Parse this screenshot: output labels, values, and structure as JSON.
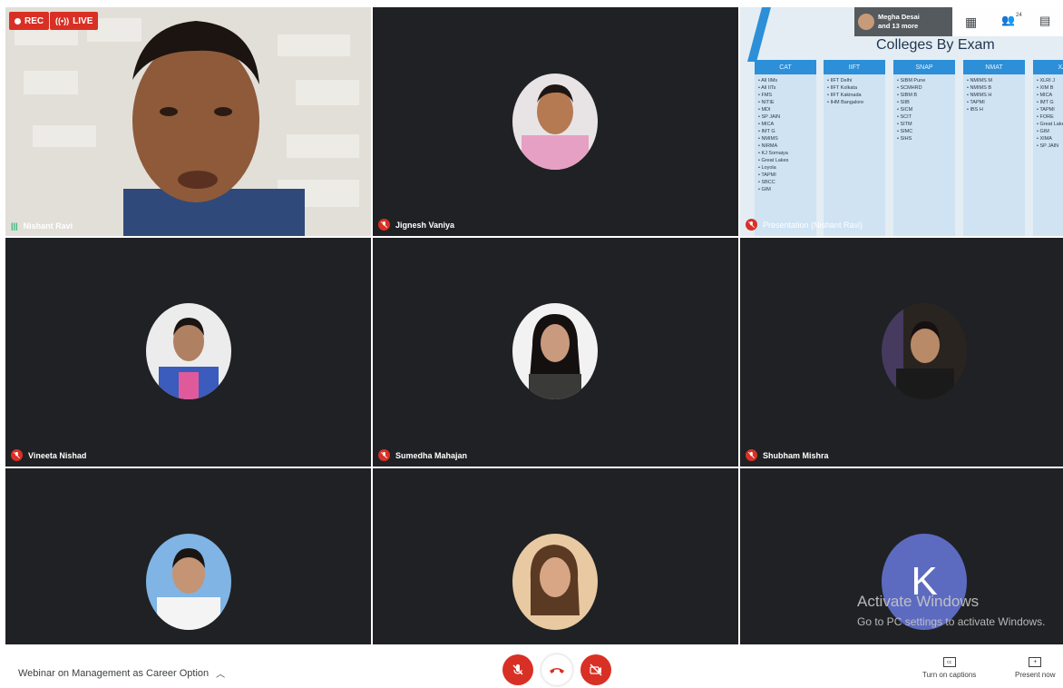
{
  "recording": {
    "rec_label": "REC",
    "live_label": "LIVE"
  },
  "tiles": {
    "nishant": {
      "name": "Nishant Ravi"
    },
    "jignesh": {
      "name": "Jignesh Vaniya"
    },
    "presentation": {
      "name": "Presentation (Nishant Ravi)",
      "slide_title": "Colleges By Exam",
      "columns": [
        {
          "head": "CAT",
          "items": [
            "All IIMs",
            "All IITs",
            "FMS",
            "NITIE",
            "MDI",
            "SP JAIN",
            "MICA",
            "IMT G",
            "NMIMS",
            "NIRMA",
            "KJ Somaiya",
            "Great Lakes",
            "Loyola",
            "TAPMI",
            "SBCC",
            "GIM"
          ]
        },
        {
          "head": "IIFT",
          "items": [
            "IIFT Delhi",
            "IIFT Kolkata",
            "IIFT Kakinada",
            "IHM Bangalore"
          ]
        },
        {
          "head": "SNAP",
          "items": [
            "SIBM Pune",
            "SCMHRD",
            "SIBM B",
            "SIIB",
            "SICM",
            "SCIT",
            "SITM",
            "SIMC",
            "SIHS"
          ]
        },
        {
          "head": "NMAT",
          "items": [
            "NMIMS M",
            "NMIMS B",
            "NMIMS H",
            "TAPMI",
            "IBS H"
          ]
        },
        {
          "head": "XAT",
          "items": [
            "XLRI J",
            "XIM B",
            "MICA",
            "IMT G",
            "TAPMI",
            "FORE",
            "Great Lakes",
            "GIM",
            "XIMA",
            "SP JAIN"
          ]
        }
      ]
    },
    "vineeta": {
      "name": "Vineeta Nishad"
    },
    "sumedha": {
      "name": "Sumedha Mahajan"
    },
    "shubham": {
      "name": "Shubham Mishra"
    },
    "k_user": {
      "initial": "K"
    }
  },
  "people": {
    "line1": "Megha Desai",
    "line2": "and 13 more",
    "count": "24"
  },
  "watermark": {
    "line1": "Activate Windows",
    "line2": "Go to PC settings to activate Windows."
  },
  "toolbar": {
    "meeting_title": "Webinar on Management as Career Option",
    "captions_label": "Turn on captions",
    "present_label": "Present now"
  },
  "colors": {
    "accent_red": "#d93025",
    "tile_bg": "#202124",
    "k_avatar": "#5c6bc0"
  }
}
